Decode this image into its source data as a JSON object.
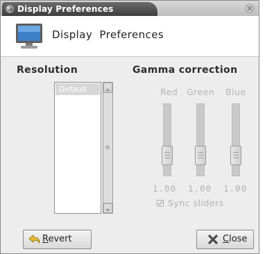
{
  "window": {
    "title": "Display Preferences",
    "header_title": "Display  Preferences"
  },
  "resolution": {
    "heading": "Resolution",
    "items": [
      "Default"
    ],
    "selected": "Default"
  },
  "gamma": {
    "heading": "Gamma  correction",
    "channels": [
      {
        "label": "Red",
        "value": "1.00",
        "level": 0.2
      },
      {
        "label": "Green",
        "value": "1.00",
        "level": 0.2
      },
      {
        "label": "Blue",
        "value": "1.00",
        "level": 0.2
      }
    ],
    "sync_label": "Sync sliders",
    "sync_checked": true,
    "disabled": true
  },
  "buttons": {
    "revert_mnemonic": "R",
    "revert_rest": "evert",
    "close_mnemonic": "C",
    "close_rest": "lose"
  },
  "colors": {
    "title_bar": "#4a4a4a",
    "disabled_text": "#b3b3b3",
    "window_bg": "#ededed"
  },
  "icons": {
    "title": "app-icon",
    "close": "close-icon",
    "header": "monitor-icon",
    "revert": "revert-arrow-icon",
    "close_button": "x-icon"
  }
}
